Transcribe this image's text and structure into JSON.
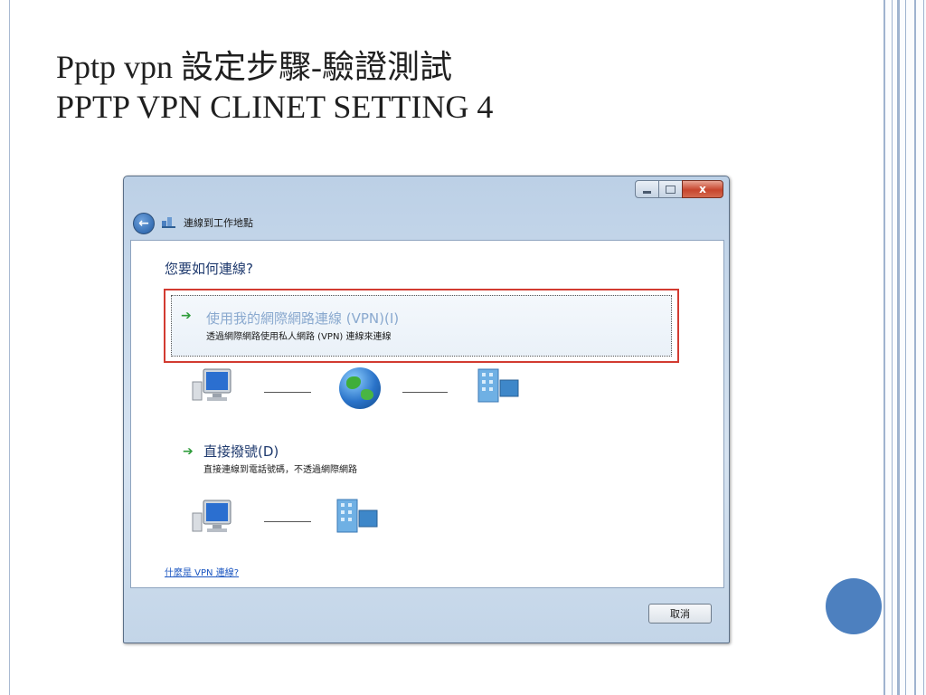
{
  "slide": {
    "title_line1": "Pptp vpn 設定步驟-驗證測試",
    "title_line2": "PPTP VPN CLINET SETTING 4"
  },
  "dialog": {
    "window_title": "連線到工作地點",
    "close_glyph": "x",
    "question": "您要如何連線?",
    "vpn_option": {
      "title": "使用我的網際網路連線 (VPN)(I)",
      "description": "透過網際網路使用私人網路 (VPN) 連線來連線",
      "highlighted": true
    },
    "dial_option": {
      "title": "直接撥號(D)",
      "description": "直接連線到電話號碼，不透過網際網路"
    },
    "help_link": "什麼是 VPN 連線?",
    "cancel_label": "取消"
  },
  "icons": [
    "back-arrow-icon",
    "network-connection-icon",
    "green-arrow-icon",
    "computer-icon",
    "globe-icon",
    "building-icon",
    "minimize-icon",
    "maximize-icon",
    "close-icon"
  ],
  "colors": {
    "highlight_border": "#d23b31",
    "accent_circle": "#4d80bf",
    "link": "#1a55c0",
    "option_arrow": "#2f9c3b"
  }
}
